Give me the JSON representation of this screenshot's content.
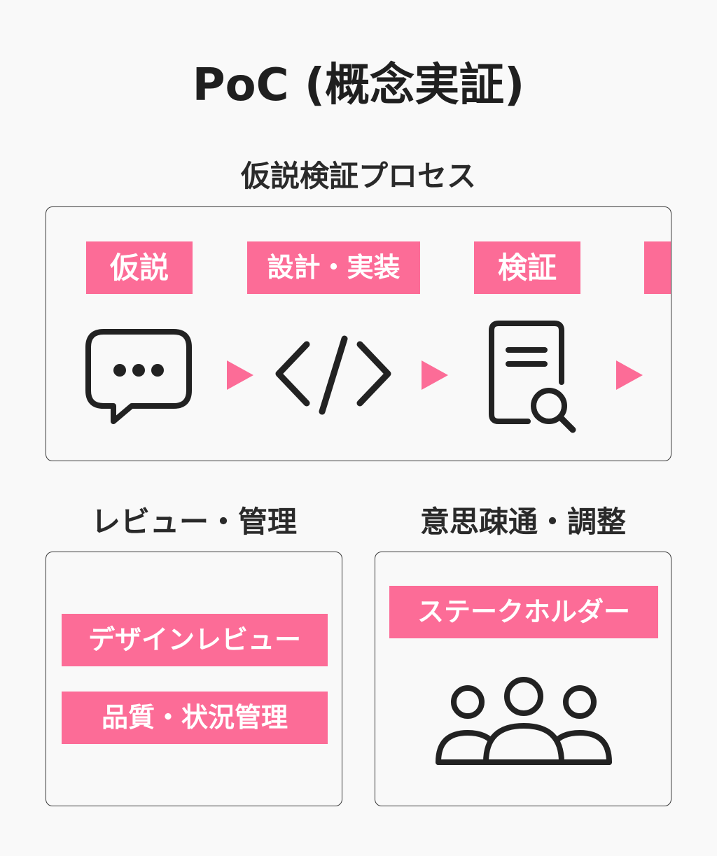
{
  "title": "PoC (概念実証)",
  "process": {
    "heading": "仮説検証プロセス",
    "steps": [
      {
        "label": "仮説",
        "icon": "speech-bubble-icon"
      },
      {
        "label": "設計・実装",
        "icon": "code-icon"
      },
      {
        "label": "検証",
        "icon": "document-search-icon"
      }
    ],
    "arrow_icon": "triangle-right-icon"
  },
  "review": {
    "heading": "レビュー・管理",
    "tags": [
      "デザインレビュー",
      "品質・状況管理"
    ]
  },
  "communication": {
    "heading": "意思疎通・調整",
    "tag": "ステークホルダー",
    "icon": "people-group-icon"
  },
  "colors": {
    "accent": "#fc6c97",
    "line": "#222222",
    "background": "#f9f9f9"
  }
}
